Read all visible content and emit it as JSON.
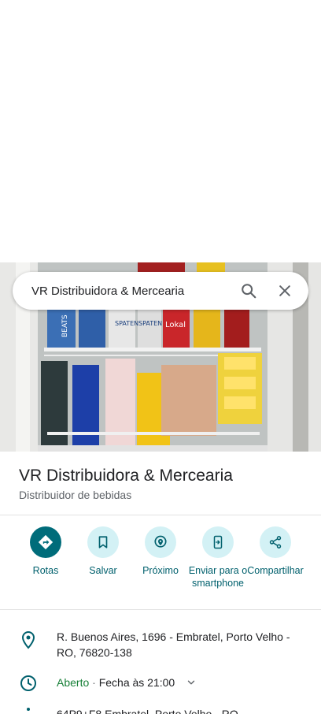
{
  "search": {
    "query": "VR Distribuidora & Mercearia",
    "search_icon": "search-icon",
    "close_icon": "close-icon"
  },
  "photo": {
    "description_icon": "place-photo",
    "brand_texts": [
      "BEATS",
      "BEATS",
      "SPATEN",
      "SPATEN",
      "Lokal"
    ]
  },
  "place": {
    "title": "VR Distribuidora & Mercearia",
    "category": "Distribuidor de bebidas"
  },
  "actions": [
    {
      "label": "Rotas",
      "icon": "directions-icon"
    },
    {
      "label": "Salvar",
      "icon": "bookmark-icon"
    },
    {
      "label": "Próximo",
      "icon": "nearby-icon"
    },
    {
      "label": "Enviar para o smartphone",
      "icon": "send-to-phone-icon"
    },
    {
      "label": "Compartilhar",
      "icon": "share-icon"
    }
  ],
  "info": {
    "address": "R. Buenos Aires, 1696 - Embratel, Porto Velho - RO, 76820-138",
    "hours_status": "Aberto",
    "hours_separator": "·",
    "hours_detail": "Fecha às 21:00",
    "plus_code": "64P9+F8 Embratel, Porto Velho - RO"
  },
  "colors": {
    "accent": "#006c7a",
    "accent_light": "#d3f1f5",
    "open_green": "#188038"
  }
}
